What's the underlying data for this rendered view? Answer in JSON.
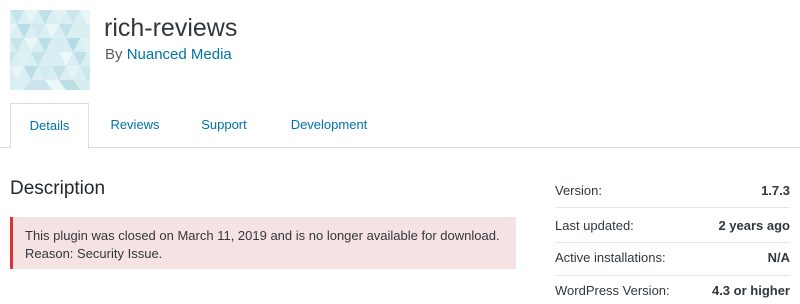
{
  "plugin": {
    "name": "rich-reviews",
    "author_prefix": "By",
    "author": "Nuanced Media"
  },
  "tabs": [
    {
      "label": "Details",
      "active": true
    },
    {
      "label": "Reviews",
      "active": false
    },
    {
      "label": "Support",
      "active": false
    },
    {
      "label": "Development",
      "active": false
    }
  ],
  "description": {
    "heading": "Description",
    "notice_line1": "This plugin was closed on March 11, 2019 and is no longer available for download.",
    "notice_line2": "Reason: Security Issue."
  },
  "meta": [
    {
      "label": "Version:",
      "value": "1.7.3"
    },
    {
      "label": "Last updated:",
      "value": "2 years ago"
    },
    {
      "label": "Active installations:",
      "value": "N/A"
    },
    {
      "label": "WordPress Version:",
      "value": "4.3 or higher"
    }
  ],
  "colors": {
    "link": "#0073aa",
    "notice_bg": "#f5e3e3",
    "notice_border": "#dc3232",
    "icon_base": "#d6eef2"
  },
  "icons": {
    "plugin_icon": "geometric-banner-icon"
  }
}
